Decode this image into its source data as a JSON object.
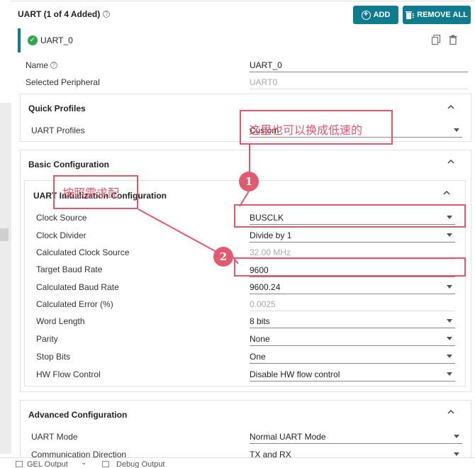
{
  "header": {
    "title": "UART (1 of 4 Added)",
    "add_label": "ADD",
    "remove_all_label": "REMOVE ALL"
  },
  "instance": {
    "name": "UART_0"
  },
  "fields_top": [
    {
      "label": "Name",
      "value": "UART_0"
    },
    {
      "label": "Selected Peripheral",
      "value": "UART0"
    }
  ],
  "quick_profiles": {
    "title": "Quick Profiles",
    "label": "UART Profiles",
    "value": "Custom"
  },
  "basic": {
    "title": "Basic Configuration"
  },
  "uart_init": {
    "title": "UART Initialization Configuration",
    "rows": [
      {
        "label": "Clock Source",
        "value": "BUSCLK"
      },
      {
        "label": "Clock Divider",
        "value": "Divide by 1"
      },
      {
        "label": "Calculated Clock Source",
        "value": "32.00 MHz"
      },
      {
        "label": "Target Baud Rate",
        "value": "9600"
      },
      {
        "label": "Calculated Baud Rate",
        "value": "9600.24"
      },
      {
        "label": "Calculated Error (%)",
        "value": "0.0025"
      },
      {
        "label": "Word Length",
        "value": "8 bits"
      },
      {
        "label": "Parity",
        "value": "None"
      },
      {
        "label": "Stop Bits",
        "value": "One"
      },
      {
        "label": "HW Flow Control",
        "value": "Disable HW flow control"
      }
    ]
  },
  "advanced": {
    "title": "Advanced Configuration",
    "rows": [
      {
        "label": "UART Mode",
        "value": "Normal UART Mode"
      },
      {
        "label": "Communication Direction",
        "value": "TX and RX"
      }
    ]
  },
  "annotations": {
    "note1": "这里也可以换成低速的",
    "note2": "按照需求配",
    "badge1": "1",
    "badge2": "2"
  },
  "bottom": {
    "tab1": "GEL Output",
    "tab2": "Debug Output"
  },
  "colors": {
    "accent": "#0e7c8c",
    "annotation": "#e8566e",
    "success": "#2ea84a"
  }
}
